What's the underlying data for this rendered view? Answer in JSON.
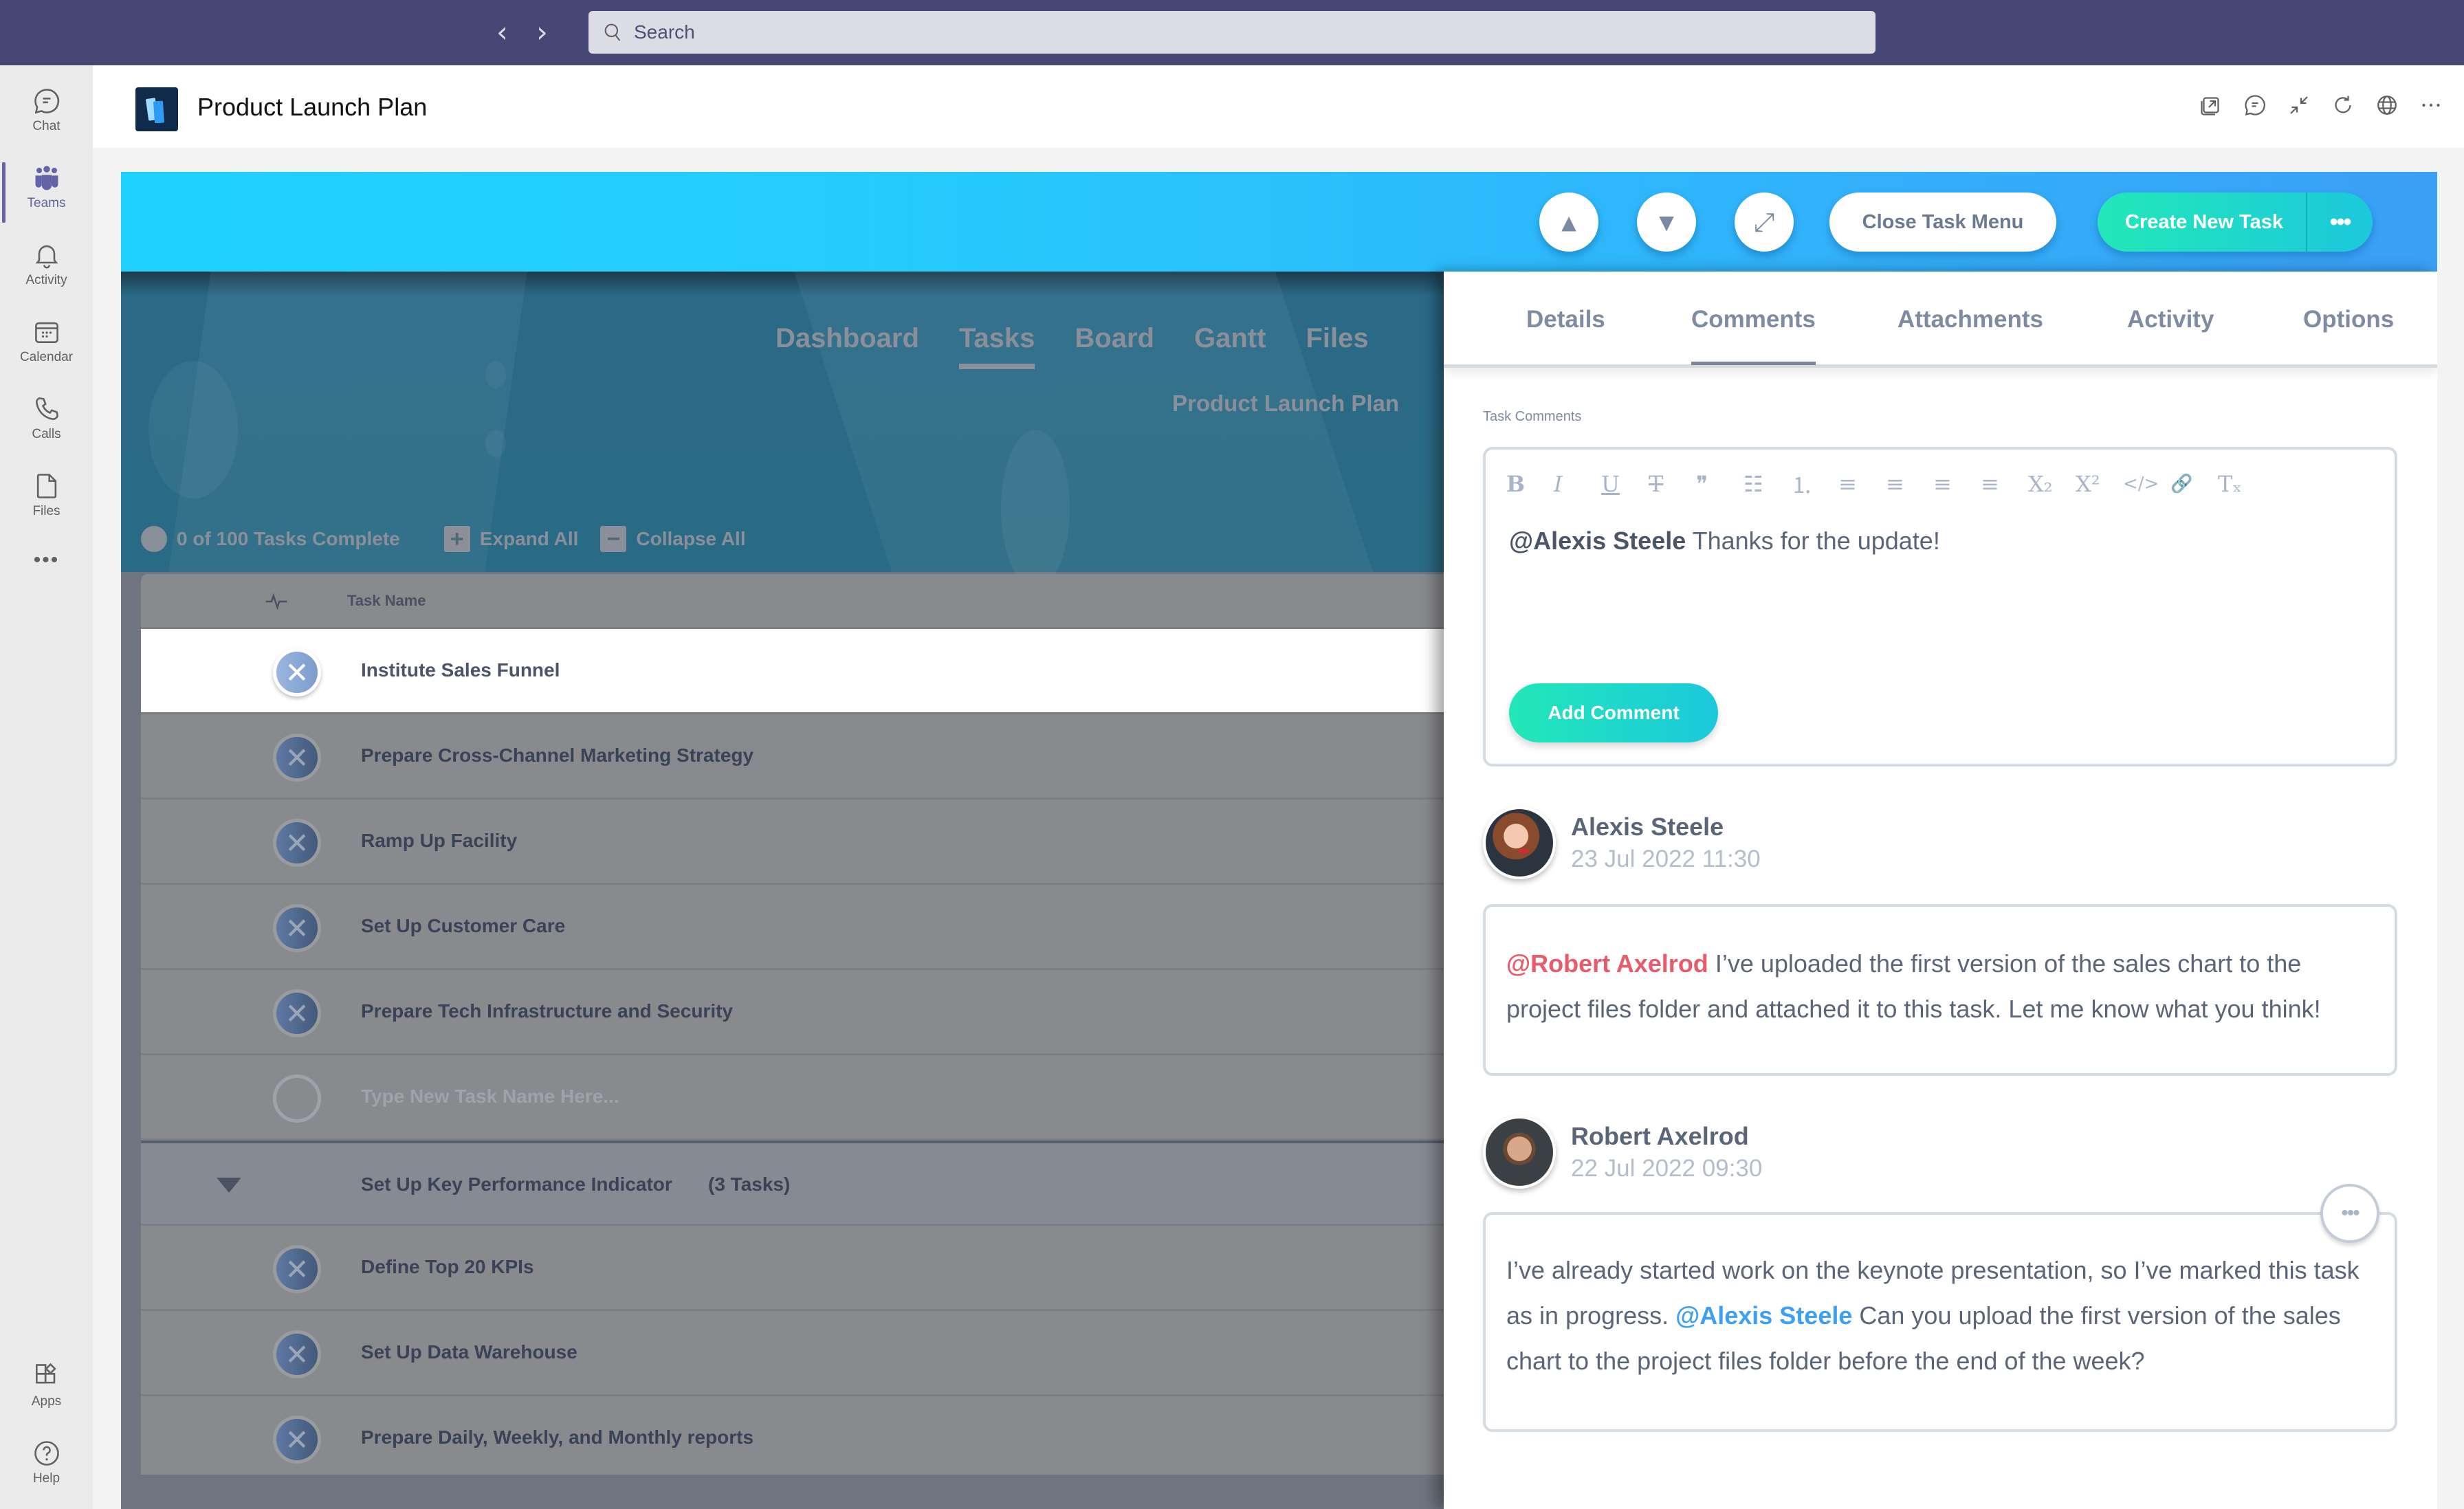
{
  "topbar": {
    "search_placeholder": "Search",
    "back_icon": "chevron-left-icon",
    "forward_icon": "chevron-right-icon"
  },
  "rail": {
    "items": [
      {
        "label": "Chat",
        "icon": "chat-icon"
      },
      {
        "label": "Teams",
        "icon": "teams-icon",
        "active": true
      },
      {
        "label": "Activity",
        "icon": "bell-icon"
      },
      {
        "label": "Calendar",
        "icon": "calendar-icon"
      },
      {
        "label": "Calls",
        "icon": "phone-icon"
      },
      {
        "label": "Files",
        "icon": "file-icon"
      },
      {
        "label": "",
        "icon": "more-icon"
      }
    ],
    "bottom": [
      {
        "label": "Apps",
        "icon": "apps-icon"
      },
      {
        "label": "Help",
        "icon": "help-icon"
      }
    ]
  },
  "header": {
    "title": "Product Launch Plan",
    "icons": [
      "popout-icon",
      "chat-icon",
      "collapse-icon",
      "refresh-icon",
      "globe-icon",
      "more-icon"
    ]
  },
  "banner": {
    "up_arrow": "▲",
    "down_arrow": "▼",
    "expand_arrow": "⤢",
    "close_task_menu": "Close Task Menu",
    "create_new_task": "Create New Task",
    "more": "•••"
  },
  "background": {
    "nav": [
      "Dashboard",
      "Tasks",
      "Board",
      "Gantt",
      "Files"
    ],
    "active_nav": "Tasks",
    "subtitle": "Product Launch Plan",
    "progress_text": "0 of 100 Tasks Complete",
    "expand_all": "Expand All",
    "collapse_all": "Collapse All",
    "plus": "+",
    "minus": "−"
  },
  "table": {
    "header": {
      "task_name": "Task Name"
    },
    "check_glyph": "✕",
    "rows": [
      {
        "name": "Institute Sales Funnel",
        "selected": true
      },
      {
        "name": "Prepare Cross-Channel Marketing Strategy"
      },
      {
        "name": "Ramp Up Facility"
      },
      {
        "name": "Set Up Customer Care"
      },
      {
        "name": "Prepare Tech Infrastructure and Security"
      }
    ],
    "new_task_placeholder": "Type New Task Name Here...",
    "group": {
      "name": "Set Up Key Performance Indicator",
      "count": "(3 Tasks)"
    },
    "group_rows": [
      {
        "name": "Define Top 20 KPIs"
      },
      {
        "name": "Set Up Data Warehouse"
      },
      {
        "name": "Prepare Daily, Weekly, and Monthly reports"
      }
    ]
  },
  "panel": {
    "tabs": [
      "Details",
      "Comments",
      "Attachments",
      "Activity",
      "Options"
    ],
    "active_tab": "Comments",
    "task_comments_label": "Task Comments",
    "toolbar": [
      "B",
      "I",
      "U",
      "T",
      "❞",
      "☷",
      "⒈",
      "≡",
      "≡",
      "≡",
      "≡",
      "X₂",
      "X²",
      "</>",
      "🔗",
      "Tₓ"
    ],
    "toolbar_names": [
      "bold-icon",
      "italic-icon",
      "underline-icon",
      "strikethrough-icon",
      "quote-icon",
      "bullet-list-icon",
      "numbered-list-icon",
      "align-justify-icon",
      "align-left-icon",
      "align-center-icon",
      "align-right-icon",
      "subscript-icon",
      "superscript-icon",
      "code-icon",
      "link-icon",
      "clear-format-icon"
    ],
    "editor": {
      "mention": "@Alexis Steele",
      "text": " Thanks for the update!"
    },
    "add_comment": "Add Comment",
    "comments": [
      {
        "author": "Alexis Steele",
        "date": "23 Jul 2022 11:30",
        "mention": "@Robert Axelrod",
        "mention_color": "#e85b6b",
        "text_after": " I’ve uploaded the first version of the sales chart to the project files folder and attached it to this task. Let me know what you think!"
      },
      {
        "author": "Robert Axelrod",
        "date": "22 Jul 2022 09:30",
        "text_before": "I’ve already started work on the keynote presentation, so I’ve marked this task as in progress. ",
        "mention": "@Alexis Steele",
        "mention_color": "#3ea0f4",
        "text_after": " Can you upload the first version of the sales chart to the project files folder before the end of the week?",
        "more": "•••"
      }
    ]
  },
  "colors": {
    "teams_bar": "#464775",
    "teams_accent": "#6264a7",
    "banner_start": "#20d0ff",
    "banner_end": "#3aa0f6",
    "create_start": "#22e8b8",
    "create_end": "#1cc8dc"
  }
}
